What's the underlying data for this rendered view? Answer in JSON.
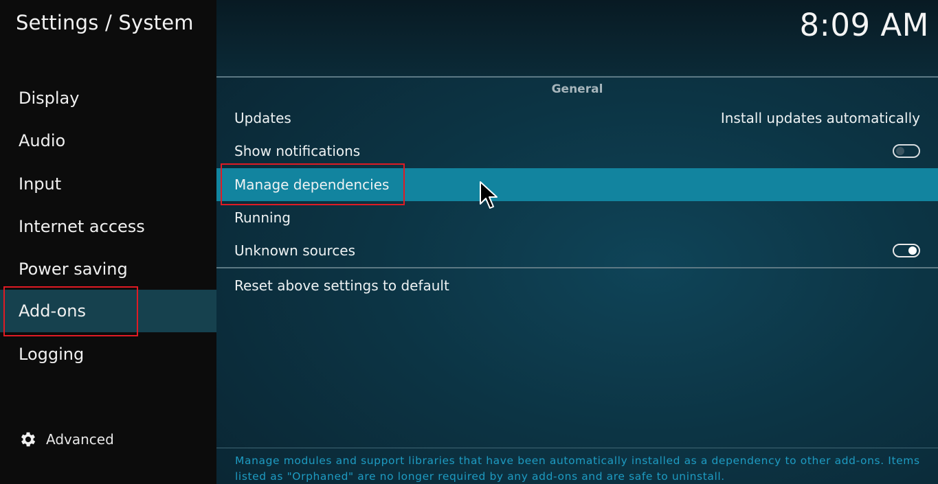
{
  "header": {
    "title": "Settings / System",
    "clock": "8:09 AM"
  },
  "sidebar": {
    "items": [
      {
        "label": "Display"
      },
      {
        "label": "Audio"
      },
      {
        "label": "Input"
      },
      {
        "label": "Internet access"
      },
      {
        "label": "Power saving"
      },
      {
        "label": "Add-ons",
        "active": true
      },
      {
        "label": "Logging"
      }
    ],
    "level": {
      "label": "Advanced",
      "icon": "gear-icon"
    }
  },
  "main": {
    "group_title": "General",
    "settings": [
      {
        "label": "Updates",
        "value": "Install updates automatically"
      },
      {
        "label": "Show notifications",
        "toggle": "off"
      },
      {
        "label": "Manage dependencies",
        "focused": true
      },
      {
        "label": "Running"
      },
      {
        "label": "Unknown sources",
        "toggle": "on"
      }
    ],
    "reset_label": "Reset above settings to default",
    "description": "Manage modules and support libraries that have been automatically installed as a dependency to other add-ons. Items listed as \"Orphaned\" are no longer required by any add-ons and are safe to uninstall."
  },
  "colors": {
    "sidebar_bg": "#0c0c0c",
    "active_nav_bg": "#16414e",
    "focused_row_bg": "#12849f",
    "description_text": "#1e9bc2",
    "annotation_red": "#e01b24"
  }
}
